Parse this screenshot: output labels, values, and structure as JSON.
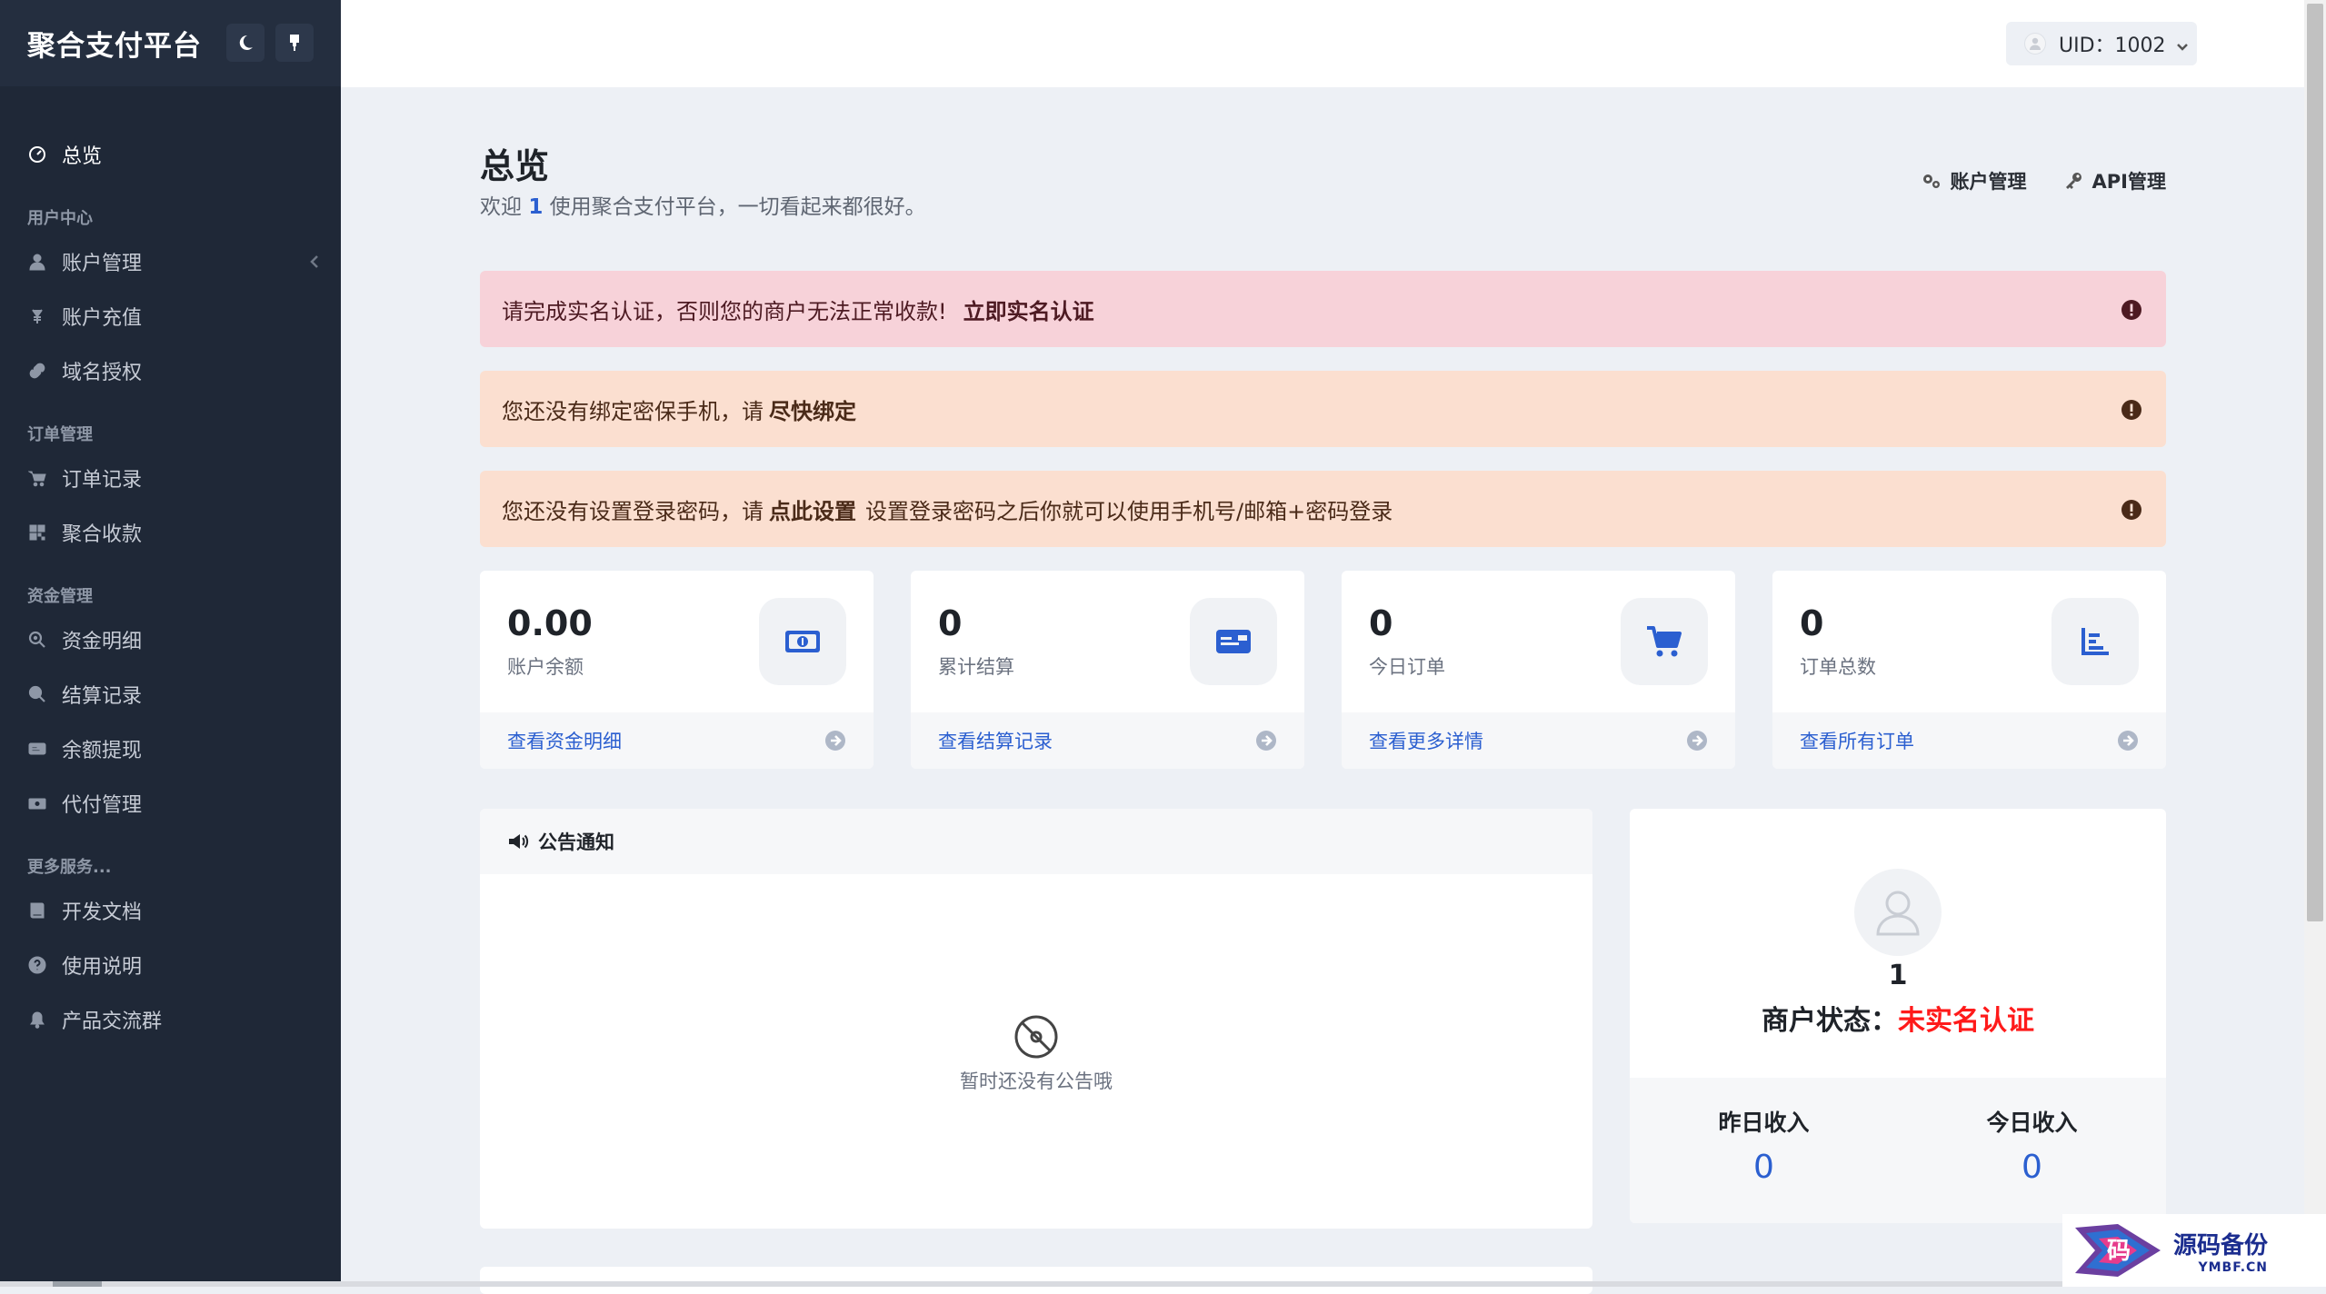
{
  "app": {
    "title": "聚合支付平台"
  },
  "header": {
    "user_label": "UID：1002"
  },
  "sidebar": {
    "items": [
      {
        "type": "item",
        "label": "总览",
        "icon": "dashboard-icon",
        "active": true
      },
      {
        "type": "section",
        "label": "用户中心"
      },
      {
        "type": "item",
        "label": "账户管理",
        "icon": "user-icon",
        "has_submenu": true
      },
      {
        "type": "item",
        "label": "账户充值",
        "icon": "yen-icon"
      },
      {
        "type": "item",
        "label": "域名授权",
        "icon": "link-icon"
      },
      {
        "type": "section",
        "label": "订单管理"
      },
      {
        "type": "item",
        "label": "订单记录",
        "icon": "cart-icon"
      },
      {
        "type": "item",
        "label": "聚合收款",
        "icon": "qrcode-icon"
      },
      {
        "type": "section",
        "label": "资金管理"
      },
      {
        "type": "item",
        "label": "资金明细",
        "icon": "search-money-icon"
      },
      {
        "type": "item",
        "label": "结算记录",
        "icon": "search-icon"
      },
      {
        "type": "item",
        "label": "余额提现",
        "icon": "card-icon"
      },
      {
        "type": "item",
        "label": "代付管理",
        "icon": "money-icon"
      },
      {
        "type": "section",
        "label": "更多服务..."
      },
      {
        "type": "item",
        "label": "开发文档",
        "icon": "book-icon"
      },
      {
        "type": "item",
        "label": "使用说明",
        "icon": "help-icon"
      },
      {
        "type": "item",
        "label": "产品交流群",
        "icon": "bell-icon"
      }
    ]
  },
  "page": {
    "title": "总览",
    "welcome_prefix": "欢迎",
    "welcome_uid": "1",
    "welcome_suffix": "使用聚合支付平台，一切看起来都很好。",
    "links": {
      "account": "账户管理",
      "api": "API管理"
    }
  },
  "alerts": [
    {
      "text": "请完成实名认证，否则您的商户无法正常收款!",
      "action": "立即实名认证",
      "after": ""
    },
    {
      "text": "您还没有绑定密保手机，请",
      "action": "尽快绑定",
      "after": ""
    },
    {
      "text": "您还没有设置登录密码，请",
      "action": "点此设置",
      "after": "设置登录密码之后你就可以使用手机号/邮箱+密码登录"
    }
  ],
  "stats": [
    {
      "value": "0.00",
      "label": "账户余额",
      "link": "查看资金明细",
      "icon": "money-icon"
    },
    {
      "value": "0",
      "label": "累计结算",
      "link": "查看结算记录",
      "icon": "card-icon"
    },
    {
      "value": "0",
      "label": "今日订单",
      "link": "查看更多详情",
      "icon": "cart-icon"
    },
    {
      "value": "0",
      "label": "订单总数",
      "link": "查看所有订单",
      "icon": "bar-chart-icon"
    }
  ],
  "notice": {
    "title": "公告通知",
    "empty": "暂时还没有公告哦"
  },
  "merchant": {
    "uid": "1",
    "status_label": "商户状态：",
    "status_value": "未实名认证",
    "yesterday_label": "昨日收入",
    "yesterday_value": "0",
    "today_label": "今日收入",
    "today_value": "0"
  },
  "watermark": {
    "main": "源码备份",
    "sub": "YMBF.CN",
    "logo_char": "码"
  },
  "colors": {
    "sidebar_bg": "#1f2837",
    "accent": "#2b5fd0",
    "danger": "#ff1a1a",
    "alert_danger": "#f7d2d9",
    "alert_warning": "#fbdfd0"
  }
}
